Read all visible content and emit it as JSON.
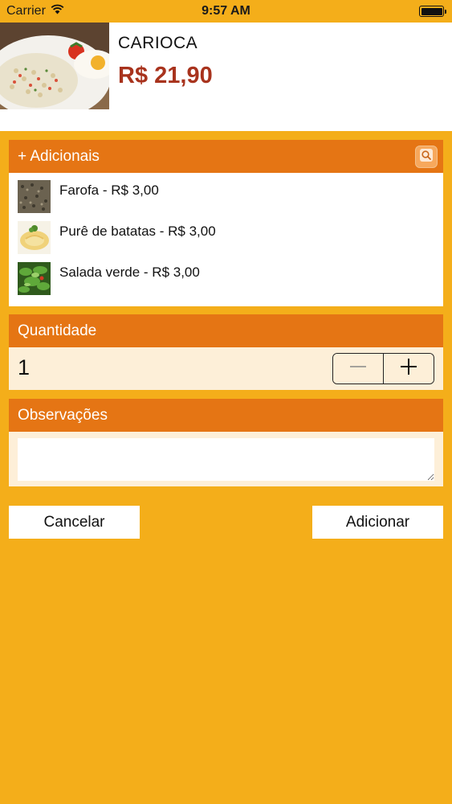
{
  "status_bar": {
    "carrier": "Carrier",
    "time": "9:57 AM"
  },
  "product": {
    "name": "CARIOCA",
    "price": "R$ 21,90"
  },
  "adicionais": {
    "title": "+ Adicionais",
    "items": [
      {
        "label": "Farofa - R$ 3,00"
      },
      {
        "label": "Purê de batatas - R$ 3,00"
      },
      {
        "label": "Salada verde - R$ 3,00"
      }
    ]
  },
  "quantidade": {
    "title": "Quantidade",
    "value": "1"
  },
  "observacoes": {
    "title": "Observações",
    "value": ""
  },
  "actions": {
    "cancel_label": "Cancelar",
    "add_label": "Adicionar"
  },
  "colors": {
    "background": "#F4AE1A",
    "header": "#E57514",
    "price": "#A8331D",
    "panel_light": "#FDEFD8"
  }
}
